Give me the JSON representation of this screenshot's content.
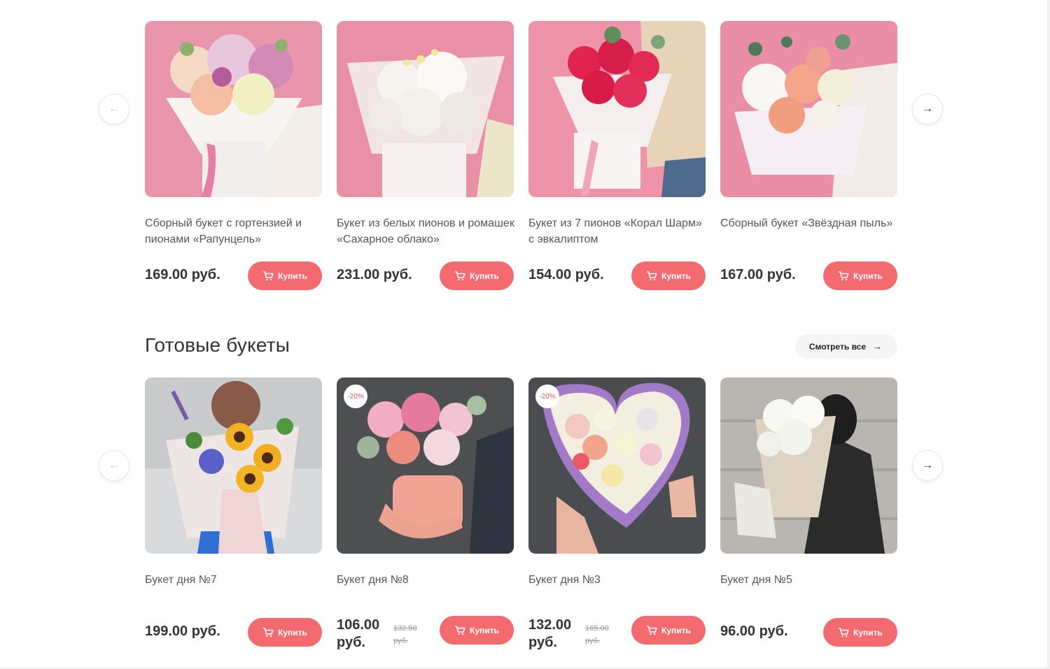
{
  "ui": {
    "accent_color": "#f36a6f",
    "buy_icon": "cart-icon",
    "prev_icon": "arrow-left-icon",
    "next_icon": "arrow-right-icon",
    "prev_glyph": "←",
    "next_glyph": "→"
  },
  "top_carousel": {
    "products": [
      {
        "name": "Сборный букет с гортензией и пионами «Рапунцель»",
        "price": "169.00 руб.",
        "buy_label": "Купить"
      },
      {
        "name": "Букет из белых пионов и ромашек «Сахарное облако»",
        "price": "231.00 руб.",
        "buy_label": "Купить"
      },
      {
        "name": "Букет из 7 пионов «Корал Шарм» с эвкалиптом",
        "price": "154.00 руб.",
        "buy_label": "Купить"
      },
      {
        "name": "Сборный букет «Звёздная пыль»",
        "price": "167.00 руб.",
        "buy_label": "Купить"
      }
    ]
  },
  "ready_bouquets": {
    "title": "Готовые букеты",
    "view_all_label": "Смотреть все",
    "view_all_glyph": "→",
    "products": [
      {
        "name": "Букет дня №7",
        "price": "199.00 руб.",
        "buy_label": "Купить"
      },
      {
        "name": "Букет дня №8",
        "badge": "-20%",
        "price": "106.00 руб.",
        "old_price": "132.50 руб.",
        "buy_label": "Купить"
      },
      {
        "name": "Букет дня №3",
        "badge": "-20%",
        "price": "132.00 руб.",
        "old_price": "165.00 руб.",
        "buy_label": "Купить"
      },
      {
        "name": "Букет дня №5",
        "price": "96.00 руб.",
        "buy_label": "Купить"
      }
    ]
  }
}
